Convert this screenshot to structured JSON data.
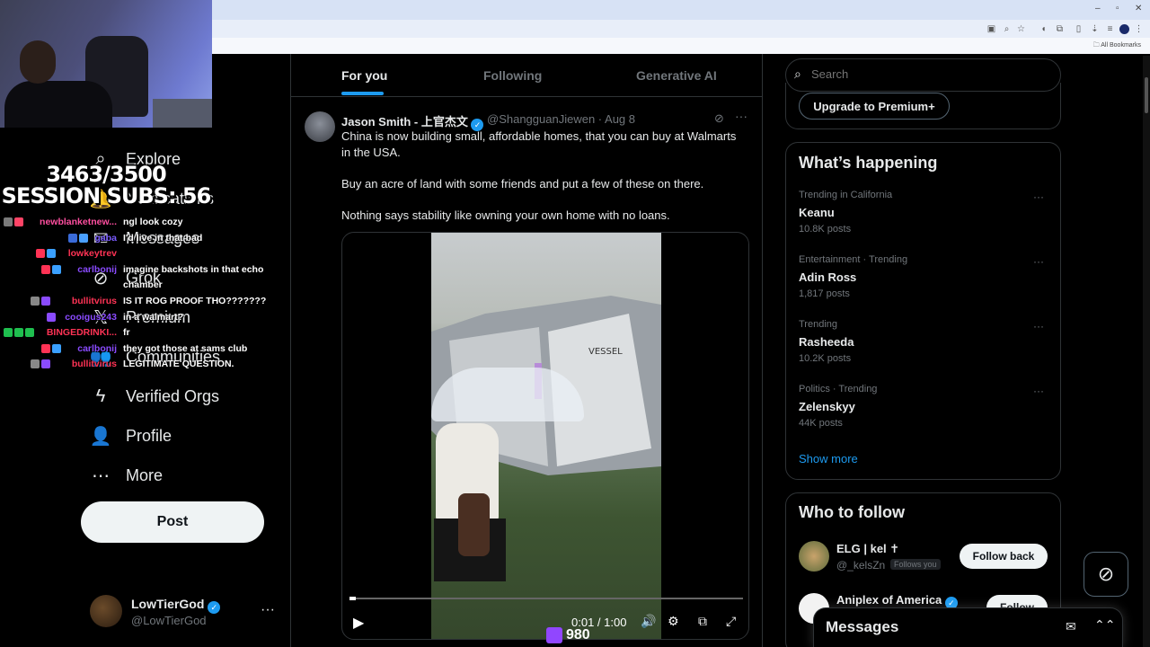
{
  "browser": {
    "window_controls": [
      "–",
      "▫",
      "✕"
    ],
    "bookmarks_label": "All Bookmarks"
  },
  "stream_overlay": {
    "sub_counter_line1": "3463/3500",
    "sub_counter_line2": "SESSION SUBS: 56",
    "viewer_count": "980",
    "chat": [
      {
        "user": "newblanketnew...",
        "message": "ngl look cozy",
        "user_color": "#ff4fa0",
        "badges": [
          "#7a7a7a",
          "#ff4466"
        ]
      },
      {
        "user": "gaba",
        "message": "I'd live in that bad",
        "user_color": "#7a5cff",
        "badges": [
          "#3a6bd8",
          "#4aa0ff"
        ]
      },
      {
        "user": "lowkeytrev",
        "message": "",
        "user_color": "#ff3355",
        "badges": [
          "#ff3355",
          "#3aa0ff"
        ]
      },
      {
        "user": "carlbonij",
        "message": "imagine backshots in that echo",
        "user_color": "#8a4bff",
        "badges": [
          "#ff3355",
          "#3aa0ff"
        ]
      },
      {
        "user": "",
        "message": "chamber",
        "user_color": "#ffffff",
        "badges": []
      },
      {
        "user": "bullitvirus",
        "message": "IS IT ROG PROOF THO???????",
        "user_color": "#ff3355",
        "badges": [
          "#888888",
          "#8a4bff"
        ]
      },
      {
        "user": "cooigus243",
        "message": "in a walmart?",
        "user_color": "#8a4bff",
        "badges": [
          "#8a4bff"
        ]
      },
      {
        "user": "BINGEDRINKI...",
        "message": "fr",
        "user_color": "#ff3355",
        "badges": [
          "#1fbf4f",
          "#1fbf4f",
          "#1fbf4f"
        ]
      },
      {
        "user": "carlbonij",
        "message": "they got those at sams club",
        "user_color": "#8a4bff",
        "badges": [
          "#ff3355",
          "#3aa0ff"
        ]
      },
      {
        "user": "bullitvirus",
        "message": "LEGITIMATE QUESTION.",
        "user_color": "#ff3355",
        "badges": [
          "#888888",
          "#8a4bff"
        ]
      }
    ]
  },
  "sidebar": {
    "items": [
      {
        "label": "Explore",
        "icon": "search-icon",
        "glyph": "⌕"
      },
      {
        "label": "Notifications",
        "icon": "bell-icon",
        "glyph": "🔔"
      },
      {
        "label": "Messages",
        "icon": "mail-icon",
        "glyph": "✉"
      },
      {
        "label": "Grok",
        "icon": "grok-icon",
        "glyph": "⊘"
      },
      {
        "label": "Premium",
        "icon": "x-logo-icon",
        "glyph": "𝕏"
      },
      {
        "label": "Communities",
        "icon": "people-icon",
        "glyph": "👥"
      },
      {
        "label": "Verified Orgs",
        "icon": "lightning-icon",
        "glyph": "ϟ"
      },
      {
        "label": "Profile",
        "icon": "person-icon",
        "glyph": "👤"
      },
      {
        "label": "More",
        "icon": "more-circle-icon",
        "glyph": "⋯"
      }
    ],
    "post_label": "Post",
    "account": {
      "name": "LowTierGod",
      "handle": "@LowTierGod",
      "more": "···"
    }
  },
  "feed": {
    "tabs": [
      {
        "label": "For you",
        "active": true
      },
      {
        "label": "Following",
        "active": false
      },
      {
        "label": "Generative AI",
        "active": false
      }
    ],
    "tweet": {
      "author_name": "Jason Smith - 上官杰文",
      "author_handle": "@ShangguanJiewen",
      "date": "Aug 8",
      "text_lines": [
        "China is now building small, affordable homes, that you can buy at Walmarts in the USA.",
        "Buy an acre of land with some friends and put a few of these on there.",
        "Nothing says stability like owning your own home with no loans."
      ],
      "video": {
        "time": "0:01 / 1:00",
        "progress": 0.017,
        "sign_text": "VESSEL"
      }
    }
  },
  "right": {
    "search_placeholder": "Search",
    "premium_label": "Upgrade to Premium+",
    "happening_title": "What’s happening",
    "trends": [
      {
        "category": "Trending in California",
        "name": "Keanu",
        "posts": "10.8K posts"
      },
      {
        "category": "Entertainment · Trending",
        "name": "Adin Ross",
        "posts": "1,817 posts"
      },
      {
        "category": "Trending",
        "name": "Rasheeda",
        "posts": "10.2K posts"
      },
      {
        "category": "Politics · Trending",
        "name": "Zelenskyy",
        "posts": "44K posts"
      }
    ],
    "show_more": "Show more",
    "who_title": "Who to follow",
    "who": [
      {
        "name": "ELG | kel ✝",
        "handle": "@_kelsZn",
        "follows_you": "Follows you",
        "button": "Follow back"
      },
      {
        "name": "Aniplex of America",
        "handle": "",
        "button": "Follow"
      }
    ],
    "messages_title": "Messages"
  },
  "colors": {
    "accent": "#1d9bf0",
    "border": "#2f3336",
    "muted": "#71767b",
    "text": "#e7e9ea"
  }
}
